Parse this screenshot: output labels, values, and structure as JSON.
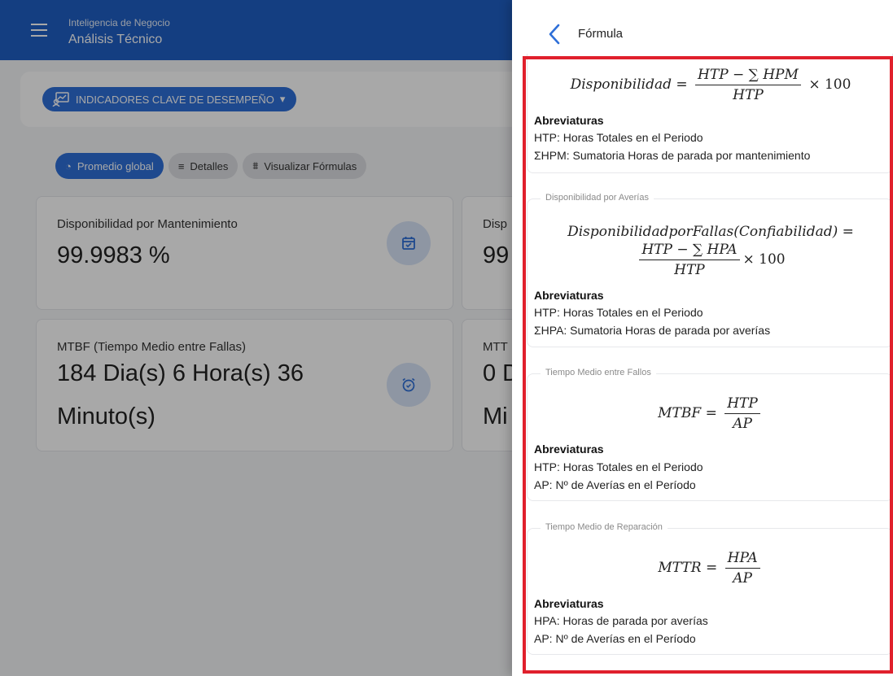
{
  "header": {
    "subtitle": "Inteligencia de Negocio",
    "title": "Análisis Técnico"
  },
  "kpi_button": {
    "label": "INDICADORES CLAVE DE DESEMPEÑO",
    "caret": "▾"
  },
  "tabs": [
    {
      "label": "Promedio global",
      "icon": "◔"
    },
    {
      "label": "Detalles",
      "icon": "≡"
    },
    {
      "label": "Visualizar Fórmulas",
      "icon": "⩩"
    }
  ],
  "cards": [
    {
      "label": "Disponibilidad por Mantenimiento",
      "value": "99.9983 %",
      "icon": "calendar-check-icon"
    },
    {
      "label": "Disp",
      "value": "99"
    },
    {
      "label": "MTBF (Tiempo Medio entre Fallas)",
      "value_line1": "184 Dia(s) 6 Hora(s) 36",
      "value_line2": "Minuto(s)",
      "icon": "alarm-clock-icon"
    },
    {
      "label": "MTT",
      "value_line1": "0 D",
      "value_line2": "Mi"
    }
  ],
  "drawer": {
    "title": "Fórmula",
    "sections": [
      {
        "legend": "",
        "formula_lhs": "Disponibilidad =",
        "numerator": "HTP − ∑ HPM",
        "denominator": "HTP",
        "multiplier": "× 100",
        "abbr_title": "Abreviaturas",
        "abbr_lines": [
          "HTP: Horas Totales en el Periodo",
          "ΣHPM: Sumatoria Horas de parada por mantenimiento"
        ]
      },
      {
        "legend": "Disponibilidad por Averías",
        "formula_lhs": "DisponibilidadporFallas(Confiabilidad) =",
        "numerator": "HTP − ∑ HPA",
        "denominator": "HTP",
        "multiplier": "× 100",
        "abbr_title": "Abreviaturas",
        "abbr_lines": [
          "HTP: Horas Totales en el Periodo",
          "ΣHPA: Sumatoria Horas de parada por averías"
        ]
      },
      {
        "legend": "Tiempo Medio entre Fallos",
        "formula_lhs": "MTBF =",
        "numerator": "HTP",
        "denominator": "AP",
        "multiplier": "",
        "abbr_title": "Abreviaturas",
        "abbr_lines": [
          "HTP: Horas Totales en el Periodo",
          "AP: Nº de Averías en el Período"
        ]
      },
      {
        "legend": "Tiempo Medio de Reparación",
        "formula_lhs": "MTTR =",
        "numerator": "HPA",
        "denominator": "AP",
        "multiplier": "",
        "abbr_title": "Abreviaturas",
        "abbr_lines": [
          "HPA: Horas de parada por averías",
          "AP: Nº de Averías en el Período"
        ]
      }
    ]
  },
  "colors": {
    "primary": "#1f5fc4",
    "highlight": "#e0202c"
  }
}
